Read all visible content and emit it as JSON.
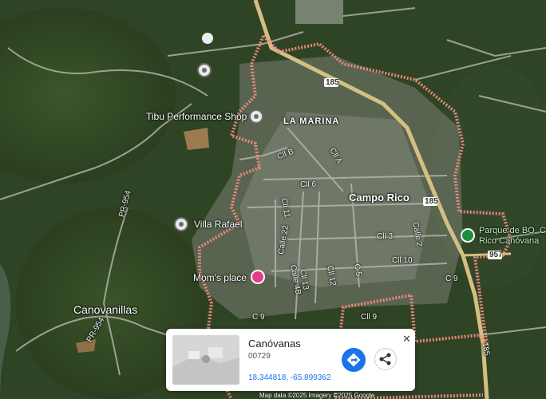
{
  "places": {
    "tibu": "Tibu Performance Shop",
    "la_marina": "LA MARINA",
    "campo_rico": "Campo Rico",
    "villa_rafael": "Villa Rafael",
    "moms_place": "Mom's place",
    "canovanillas": "Canovanillas",
    "parque_line1": "Parque de BO. C",
    "parque_line2": "Rico Canóvana"
  },
  "streets": {
    "cll_b": "Cll B",
    "cll_a": "Cll A",
    "cll_6": "Cll 6",
    "cll_11": "Cll 11",
    "calle_22": "Calle 22",
    "cll_3": "Cll 3",
    "calle_2": "Calle 2",
    "cll_10": "Cll 10",
    "calle_4b": "Calle 4B",
    "cll_13": "Cll 13",
    "cll_12": "Cll 12",
    "c_5": "C 5",
    "c_9a": "C 9",
    "c_9b": "C 9",
    "cll_9": "Cll 9"
  },
  "routes": {
    "r185_top": "185",
    "r185_mid": "185",
    "r185_bottom": "185",
    "r957": "957",
    "pr954_top": "PR-954",
    "pr954_bottom": "PR-954"
  },
  "info_card": {
    "title": "Canóvanas",
    "zip": "00729",
    "coordinates": "18.344818, -65.899362",
    "close": "✕"
  },
  "attribution": "Map data ©2025 Imagery ©2025 Google",
  "colors": {
    "boundary": "#f08a80",
    "highway": "#d4bf83",
    "pin_pink": "#e03d8c",
    "pin_green": "#1e8e3e",
    "action_blue": "#1a73e8"
  }
}
